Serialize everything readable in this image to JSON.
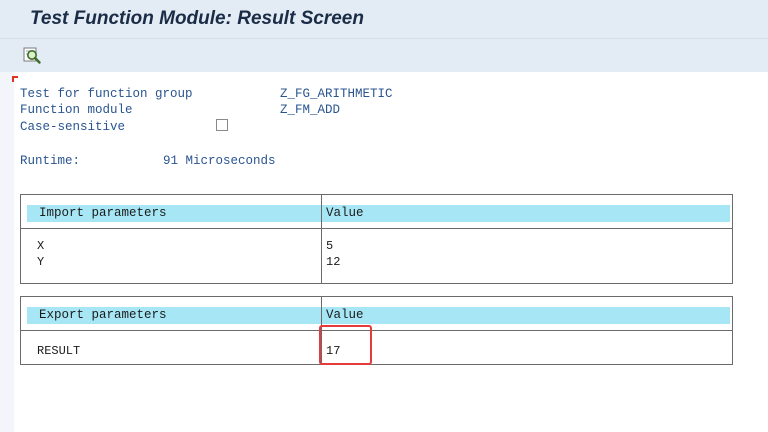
{
  "window": {
    "title": "Test Function Module: Result Screen"
  },
  "toolbar": {
    "display_icon": "magnifier-display-icon"
  },
  "info": {
    "function_group_label": "Test for function group",
    "function_group_value": "Z_FG_ARITHMETIC",
    "function_module_label": "Function module",
    "function_module_value": "Z_FM_ADD",
    "case_sensitive_label": "Case-sensitive",
    "case_sensitive_checked": false,
    "runtime_label": "Runtime:",
    "runtime_value": "91 Microseconds"
  },
  "import_table": {
    "header_param": "Import parameters",
    "header_value": "Value",
    "rows": [
      {
        "name": "X",
        "value": "5"
      },
      {
        "name": "Y",
        "value": "12"
      }
    ]
  },
  "export_table": {
    "header_param": "Export parameters",
    "header_value": "Value",
    "rows": [
      {
        "name": "RESULT",
        "value": "17"
      }
    ]
  },
  "colors": {
    "title_bar": "#e3ecf5",
    "label_text": "#2a5590",
    "table_header": "#a6e6f5",
    "highlight_box": "#e53b3b"
  }
}
